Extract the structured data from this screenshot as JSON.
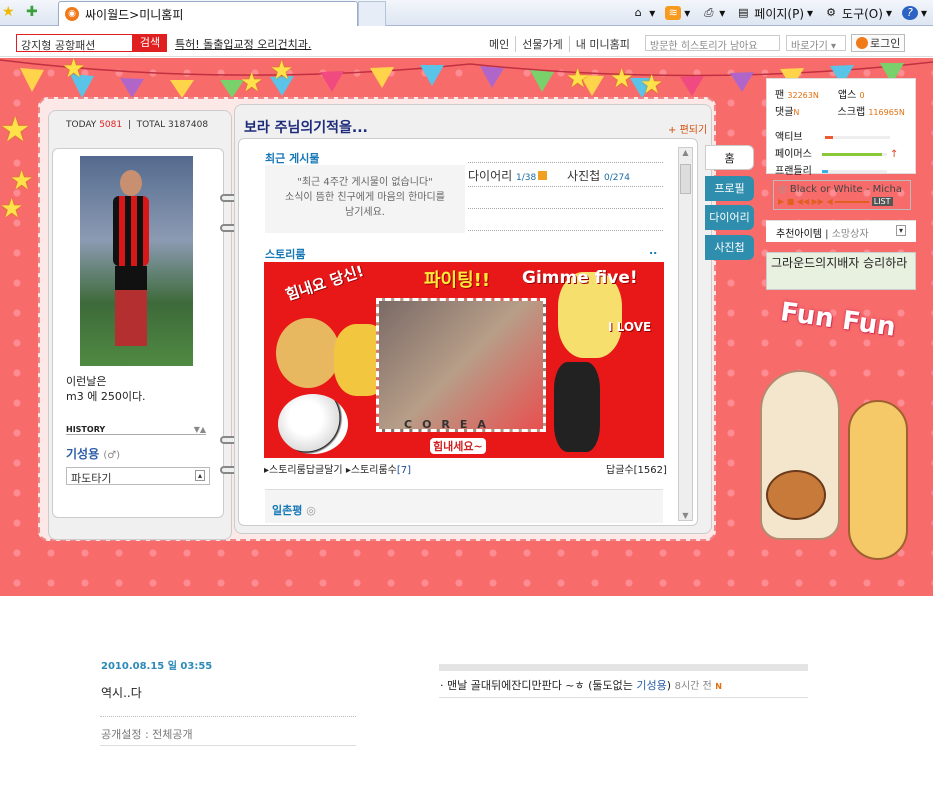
{
  "browser": {
    "tab_title": "싸이월드>미니홈피",
    "tools": {
      "page": "페이지(P)",
      "tools": "도구(O)"
    }
  },
  "cyworld": {
    "search_value": "강지형 공항패션",
    "search_button": "검색",
    "ticker": "특허! 돌출입교정 오리건치과.",
    "nav": [
      "메인",
      "선물가게",
      "내 미니홈피"
    ],
    "history_placeholder": "방문한 히스토리가 남아요",
    "go_label": "바로가기",
    "login": "로그인"
  },
  "homepage": {
    "today_label": "TODAY",
    "today": "5081",
    "total_label": "TOTAL",
    "total": "3187408",
    "mood": "이런날은\nm3 에 250이다.",
    "history_label": "HISTORY",
    "owner": "기성용",
    "owner_gender": "(♂)",
    "wave": "파도타기",
    "title": "보라 주님의기적을...",
    "edit": "편되기",
    "recent_title": "최근 게시물",
    "recent_empty1": "\"최근 4주간 게시물이 없습니다\"",
    "recent_empty2": "소식이 뜸한 친구에게 마음의 한마디를",
    "recent_empty3": "남기세요.",
    "diary_label": "다이어리",
    "diary_count": "1/38",
    "photo_label": "사진첩",
    "photo_count": "0/274",
    "story_title": "스토리룸",
    "story_more": "..",
    "story_texts": {
      "fighting": "파이팅!!",
      "gimme": "Gimme five!",
      "cheer": "힘내요 당신!",
      "love": "I LOVE",
      "korea": "COREA",
      "hello": "힘내세요~"
    },
    "story_reply_link": "스토리룸답글달기",
    "story_count_link": "스토리룸수",
    "story_count": "[7]",
    "reply_count_label": "답글수",
    "reply_count": "[1562]",
    "ilchon_title": "일촌평"
  },
  "tabs": [
    "홈",
    "프로필",
    "다이어리",
    "사진첩"
  ],
  "side": {
    "fan_label": "팬",
    "fan": "32263",
    "apps_label": "앱스",
    "apps": "0",
    "reply_label": "댓글",
    "scrap_label": "스크랩",
    "scrap": "116965",
    "active": "액티브",
    "famous": "페이머스",
    "friendly": "프랜들리",
    "song": "Black or White - Micha",
    "rec_item": "추천아이템",
    "gift_box": "소망상자",
    "banner": "그라운드의지배자 승리하라",
    "funfun": "Fun Fun",
    "new_badge": "N"
  },
  "post": {
    "date": "2010.08.15 일  03:55",
    "body": "역시..다",
    "privacy": "공개설정 : 전체공개",
    "comment_text": "· 맨날 골대뒤에잔디만판다 ~ㅎ (둘도없는",
    "comment_author": "기성용",
    "comment_close": ")",
    "comment_time": "8시간 전",
    "comment_new": "N"
  },
  "colors": {
    "background": "#f86b6b",
    "accent": "#e02020",
    "link": "#1778b8",
    "tab": "#2f8eae"
  }
}
